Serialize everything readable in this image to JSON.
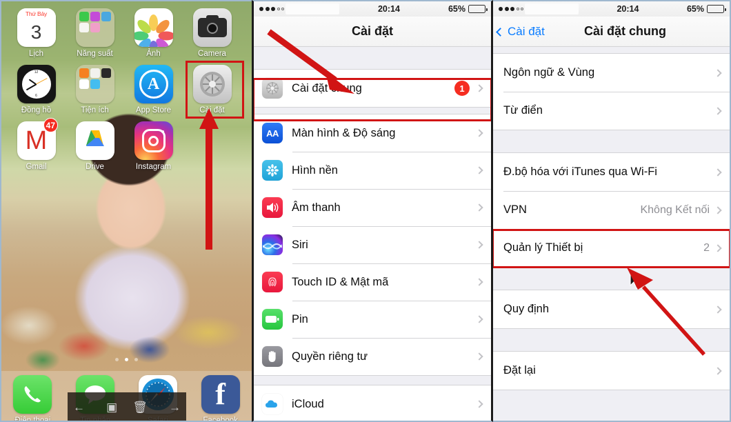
{
  "home_screen": {
    "page_dots": {
      "count": 3,
      "active_index": 1
    },
    "rows": [
      [
        {
          "name": "Lịch",
          "icon": "calendar-icon",
          "calendar_weekday": "Thứ Bảy",
          "calendar_day": "3"
        },
        {
          "name": "Năng suất",
          "icon": "folder-icon"
        },
        {
          "name": "Ảnh",
          "icon": "photos-icon"
        },
        {
          "name": "Camera",
          "icon": "camera-icon"
        }
      ],
      [
        {
          "name": "Đồng hồ",
          "icon": "clock-icon"
        },
        {
          "name": "Tiện ích",
          "icon": "folder-icon"
        },
        {
          "name": "App Store",
          "icon": "app-store-icon"
        },
        {
          "name": "Cài đặt",
          "icon": "settings-gear-icon",
          "highlighted": true
        }
      ],
      [
        {
          "name": "Gmail",
          "icon": "gmail-icon",
          "badge": "47"
        },
        {
          "name": "Drive",
          "icon": "google-drive-icon"
        },
        {
          "name": "Instagram",
          "icon": "instagram-icon"
        }
      ]
    ],
    "dock": [
      {
        "name": "Điện thoại",
        "icon": "phone-icon"
      },
      {
        "name": "Tin nhắn",
        "icon": "messages-icon"
      },
      {
        "name": "Safari",
        "icon": "safari-compass-icon"
      },
      {
        "name": "Facebook",
        "icon": "facebook-icon"
      }
    ],
    "overlay_toolbar": {
      "back": "←",
      "message": "▣",
      "trash": "🗑",
      "forward": "→"
    }
  },
  "settings_screen": {
    "status_bar": {
      "signal_dots_filled": 3,
      "signal_dots_total": 5,
      "time": "20:14",
      "battery_percent": "65%",
      "battery_level": 65
    },
    "nav": {
      "title": "Cài đặt"
    },
    "items": [
      {
        "label": "Cài đặt chung",
        "icon": "gear-icon",
        "badge": "1",
        "highlighted": true
      },
      {
        "label": "Màn hình & Độ sáng",
        "icon": "display-aa-icon"
      },
      {
        "label": "Hình nền",
        "icon": "wallpaper-flower-icon"
      },
      {
        "label": "Âm thanh",
        "icon": "sound-speaker-icon"
      },
      {
        "label": "Siri",
        "icon": "siri-waveform-icon"
      },
      {
        "label": "Touch ID & Mật mã",
        "icon": "fingerprint-icon"
      },
      {
        "label": "Pin",
        "icon": "battery-icon"
      },
      {
        "label": "Quyền riêng tư",
        "icon": "privacy-hand-icon"
      },
      {
        "label": "iCloud",
        "icon": "icloud-icon"
      }
    ]
  },
  "general_screen": {
    "status_bar": {
      "signal_dots_filled": 3,
      "signal_dots_total": 5,
      "time": "20:14",
      "battery_percent": "65%",
      "battery_level": 65
    },
    "nav": {
      "back_label": "Cài đặt",
      "title": "Cài đặt chung"
    },
    "group1": [
      {
        "label": "Ngôn ngữ & Vùng",
        "value": ""
      },
      {
        "label": "Từ điển",
        "value": ""
      }
    ],
    "group2": [
      {
        "label": "Đ.bộ hóa với iTunes qua Wi-Fi",
        "value": ""
      },
      {
        "label": "VPN",
        "value": "Không Kết nối"
      },
      {
        "label": "Quản lý Thiết bị",
        "value": "2",
        "highlighted": true
      }
    ],
    "group3": [
      {
        "label": "Quy định",
        "value": ""
      }
    ],
    "group4": [
      {
        "label": "Đặt lại",
        "value": ""
      }
    ]
  },
  "annotations": {
    "accent_color": "#d11414",
    "arrow_home_to_settings": "vertical arrow pointing up to Cài đặt app icon",
    "arrow_to_general_row": "diagonal arrow pointing to Cài đặt chung row",
    "cursor_to_device_mgmt": "mouse cursor below Quản lý Thiết bị row",
    "arrow_to_device_mgmt": "diagonal arrow pointing up-left to Quản lý Thiết bị row"
  },
  "colors": {
    "accent_red": "#d11414",
    "badge_red": "#f52d21",
    "ios_blue": "#0a7cff",
    "group_bg": "#efeff4",
    "value_gray": "#8e8e93"
  }
}
